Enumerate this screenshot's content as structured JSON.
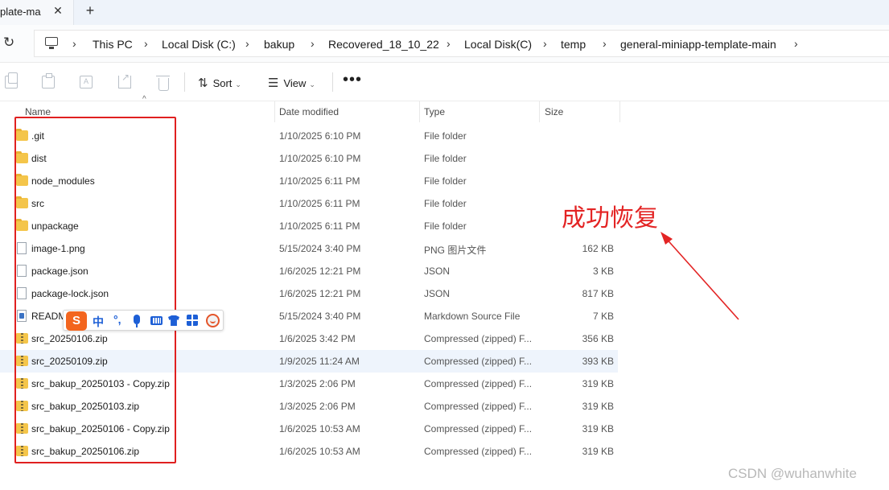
{
  "tab": {
    "title": "plate-ma",
    "close_glyph": "✕",
    "new_glyph": "+"
  },
  "address": {
    "refresh_glyph": "↻",
    "crumbs": [
      "This PC",
      "Local Disk (C:)",
      "bakup",
      "Recovered_18_10_22",
      "Local Disk(C)",
      "temp",
      "general-miniapp-template-main"
    ],
    "chevron": "›"
  },
  "toolbar": {
    "sort_label": "Sort",
    "view_label": "View",
    "more_glyph": "•••",
    "sort_glyph": "⇅",
    "view_glyph": "☰",
    "caret": "⌄"
  },
  "columns": {
    "name": "Name",
    "date": "Date modified",
    "type": "Type",
    "size": "Size",
    "sort_arrow": "^"
  },
  "files": [
    {
      "name": ".git",
      "date": "1/10/2025 6:10 PM",
      "type": "File folder",
      "size": "",
      "icon": "folder-icon"
    },
    {
      "name": "dist",
      "date": "1/10/2025 6:10 PM",
      "type": "File folder",
      "size": "",
      "icon": "folder-icon"
    },
    {
      "name": "node_modules",
      "date": "1/10/2025 6:11 PM",
      "type": "File folder",
      "size": "",
      "icon": "folder-icon"
    },
    {
      "name": "src",
      "date": "1/10/2025 6:11 PM",
      "type": "File folder",
      "size": "",
      "icon": "folder-icon"
    },
    {
      "name": "unpackage",
      "date": "1/10/2025 6:11 PM",
      "type": "File folder",
      "size": "",
      "icon": "folder-icon"
    },
    {
      "name": "image-1.png",
      "date": "5/15/2024 3:40 PM",
      "type": "PNG 图片文件",
      "size": "162 KB",
      "icon": "image-file-icon"
    },
    {
      "name": "package.json",
      "date": "1/6/2025 12:21 PM",
      "type": "JSON",
      "size": "3 KB",
      "icon": "file-icon"
    },
    {
      "name": "package-lock.json",
      "date": "1/6/2025 12:21 PM",
      "type": "JSON",
      "size": "817 KB",
      "icon": "file-icon"
    },
    {
      "name": "READM",
      "date": "5/15/2024 3:40 PM",
      "type": "Markdown Source File",
      "size": "7 KB",
      "icon": "markdown-file-icon"
    },
    {
      "name": "src_20250106.zip",
      "date": "1/6/2025 3:42 PM",
      "type": "Compressed (zipped) F...",
      "size": "356 KB",
      "icon": "zip-folder-icon"
    },
    {
      "name": "src_20250109.zip",
      "date": "1/9/2025 11:24 AM",
      "type": "Compressed (zipped) F...",
      "size": "393 KB",
      "icon": "zip-folder-icon",
      "selected": true
    },
    {
      "name": "src_bakup_20250103 - Copy.zip",
      "date": "1/3/2025 2:06 PM",
      "type": "Compressed (zipped) F...",
      "size": "319 KB",
      "icon": "zip-folder-icon"
    },
    {
      "name": "src_bakup_20250103.zip",
      "date": "1/3/2025 2:06 PM",
      "type": "Compressed (zipped) F...",
      "size": "319 KB",
      "icon": "zip-folder-icon"
    },
    {
      "name": "src_bakup_20250106 - Copy.zip",
      "date": "1/6/2025 10:53 AM",
      "type": "Compressed (zipped) F...",
      "size": "319 KB",
      "icon": "zip-folder-icon"
    },
    {
      "name": "src_bakup_20250106.zip",
      "date": "1/6/2025 10:53 AM",
      "type": "Compressed (zipped) F...",
      "size": "319 KB",
      "icon": "zip-folder-icon"
    }
  ],
  "annotation": {
    "text": "成功恢复",
    "color": "#e32424"
  },
  "ime": {
    "logo": "S",
    "lang": "中",
    "punct": "°,"
  },
  "watermark": "CSDN @wuhanwhite",
  "colors": {
    "selected_row": "#eef4fc",
    "folder": "#f4c54a",
    "highlight_box": "#e02020"
  }
}
